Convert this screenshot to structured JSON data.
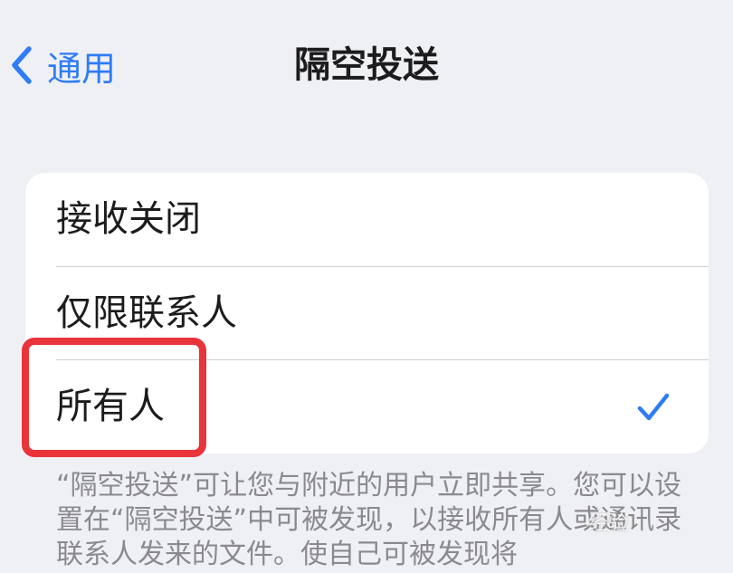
{
  "nav": {
    "back_label": "通用",
    "title": "隔空投送"
  },
  "options": [
    {
      "label": "接收关闭",
      "selected": false
    },
    {
      "label": "仅限联系人",
      "selected": false
    },
    {
      "label": "所有人",
      "selected": true
    }
  ],
  "footer": {
    "text": "“隔空投送”可让您与附近的用户立即共享。您可以设置在“隔空投送”中可被发现，以接收所有人或通讯录联系人发来的文件。使自己可被发现将"
  },
  "annotation": {
    "highlight_color": "#e8343a"
  },
  "watermark": {
    "text": "经验"
  },
  "colors": {
    "accent": "#2f7cf6",
    "background": "#eff0f4",
    "card": "#ffffff"
  }
}
